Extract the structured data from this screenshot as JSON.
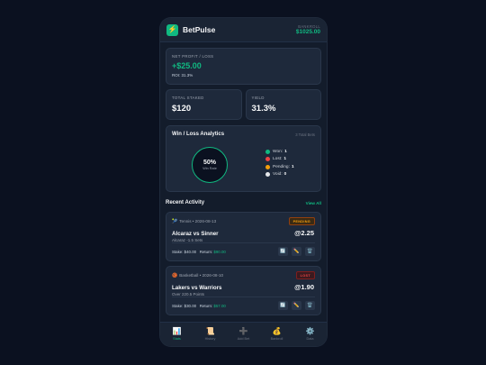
{
  "header": {
    "brand": "BetPulse",
    "logo_icon": "lightning-icon",
    "bankroll_label": "BANKROLL",
    "bankroll_value": "$1025.00"
  },
  "profit": {
    "label": "NET PROFIT / LOSS",
    "value": "+$25.00",
    "roi": "ROI: 31.3%"
  },
  "stats": [
    {
      "label": "TOTAL STAKED",
      "value": "$120"
    },
    {
      "label": "YIELD",
      "value": "31.3%"
    }
  ],
  "analytics": {
    "title": "Win / Loss Analytics",
    "total": "3 Total Bets",
    "win_rate_pct": "50%",
    "win_rate_label": "Win Rate",
    "win_rate_value": 0.5,
    "legend": [
      {
        "label": "Won:",
        "count": "1",
        "color": "#10b981"
      },
      {
        "label": "Lost:",
        "count": "1",
        "color": "#ef4444"
      },
      {
        "label": "Pending:",
        "count": "1",
        "color": "#f59e0b"
      },
      {
        "label": "Void:",
        "count": "0",
        "color": "#e5e7eb"
      }
    ]
  },
  "recent": {
    "title": "Recent Activity",
    "view_all": "View All",
    "bets": [
      {
        "sport_icon": "tennis-icon",
        "meta": "Tennis • 2026-08-13",
        "status": "PENDING",
        "matchup": "Alcaraz vs Sinner",
        "market": "Alcaraz -1.5 Sets",
        "odds": "@2.25",
        "stake": "Stake: $40.00",
        "return_label": "Return:",
        "return_value": "$90.00"
      },
      {
        "sport_icon": "basketball-icon",
        "meta": "Basketball • 2026-08-10",
        "status": "LOST",
        "matchup": "Lakers vs Warriors",
        "market": "Over 220.5 Points",
        "odds": "@1.90",
        "stake": "Stake: $30.00",
        "return_label": "Return:",
        "return_value": "$57.00"
      }
    ]
  },
  "nav": [
    {
      "label": "Stats",
      "icon": "chart-icon"
    },
    {
      "label": "History",
      "icon": "scroll-icon"
    },
    {
      "label": "Add Bet",
      "icon": "plus-icon"
    },
    {
      "label": "Bankroll",
      "icon": "money-bag-icon"
    },
    {
      "label": "Data",
      "icon": "gear-icon"
    }
  ],
  "colors": {
    "accent": "#10b981",
    "background": "#0b1120",
    "card": "#1e293b"
  }
}
